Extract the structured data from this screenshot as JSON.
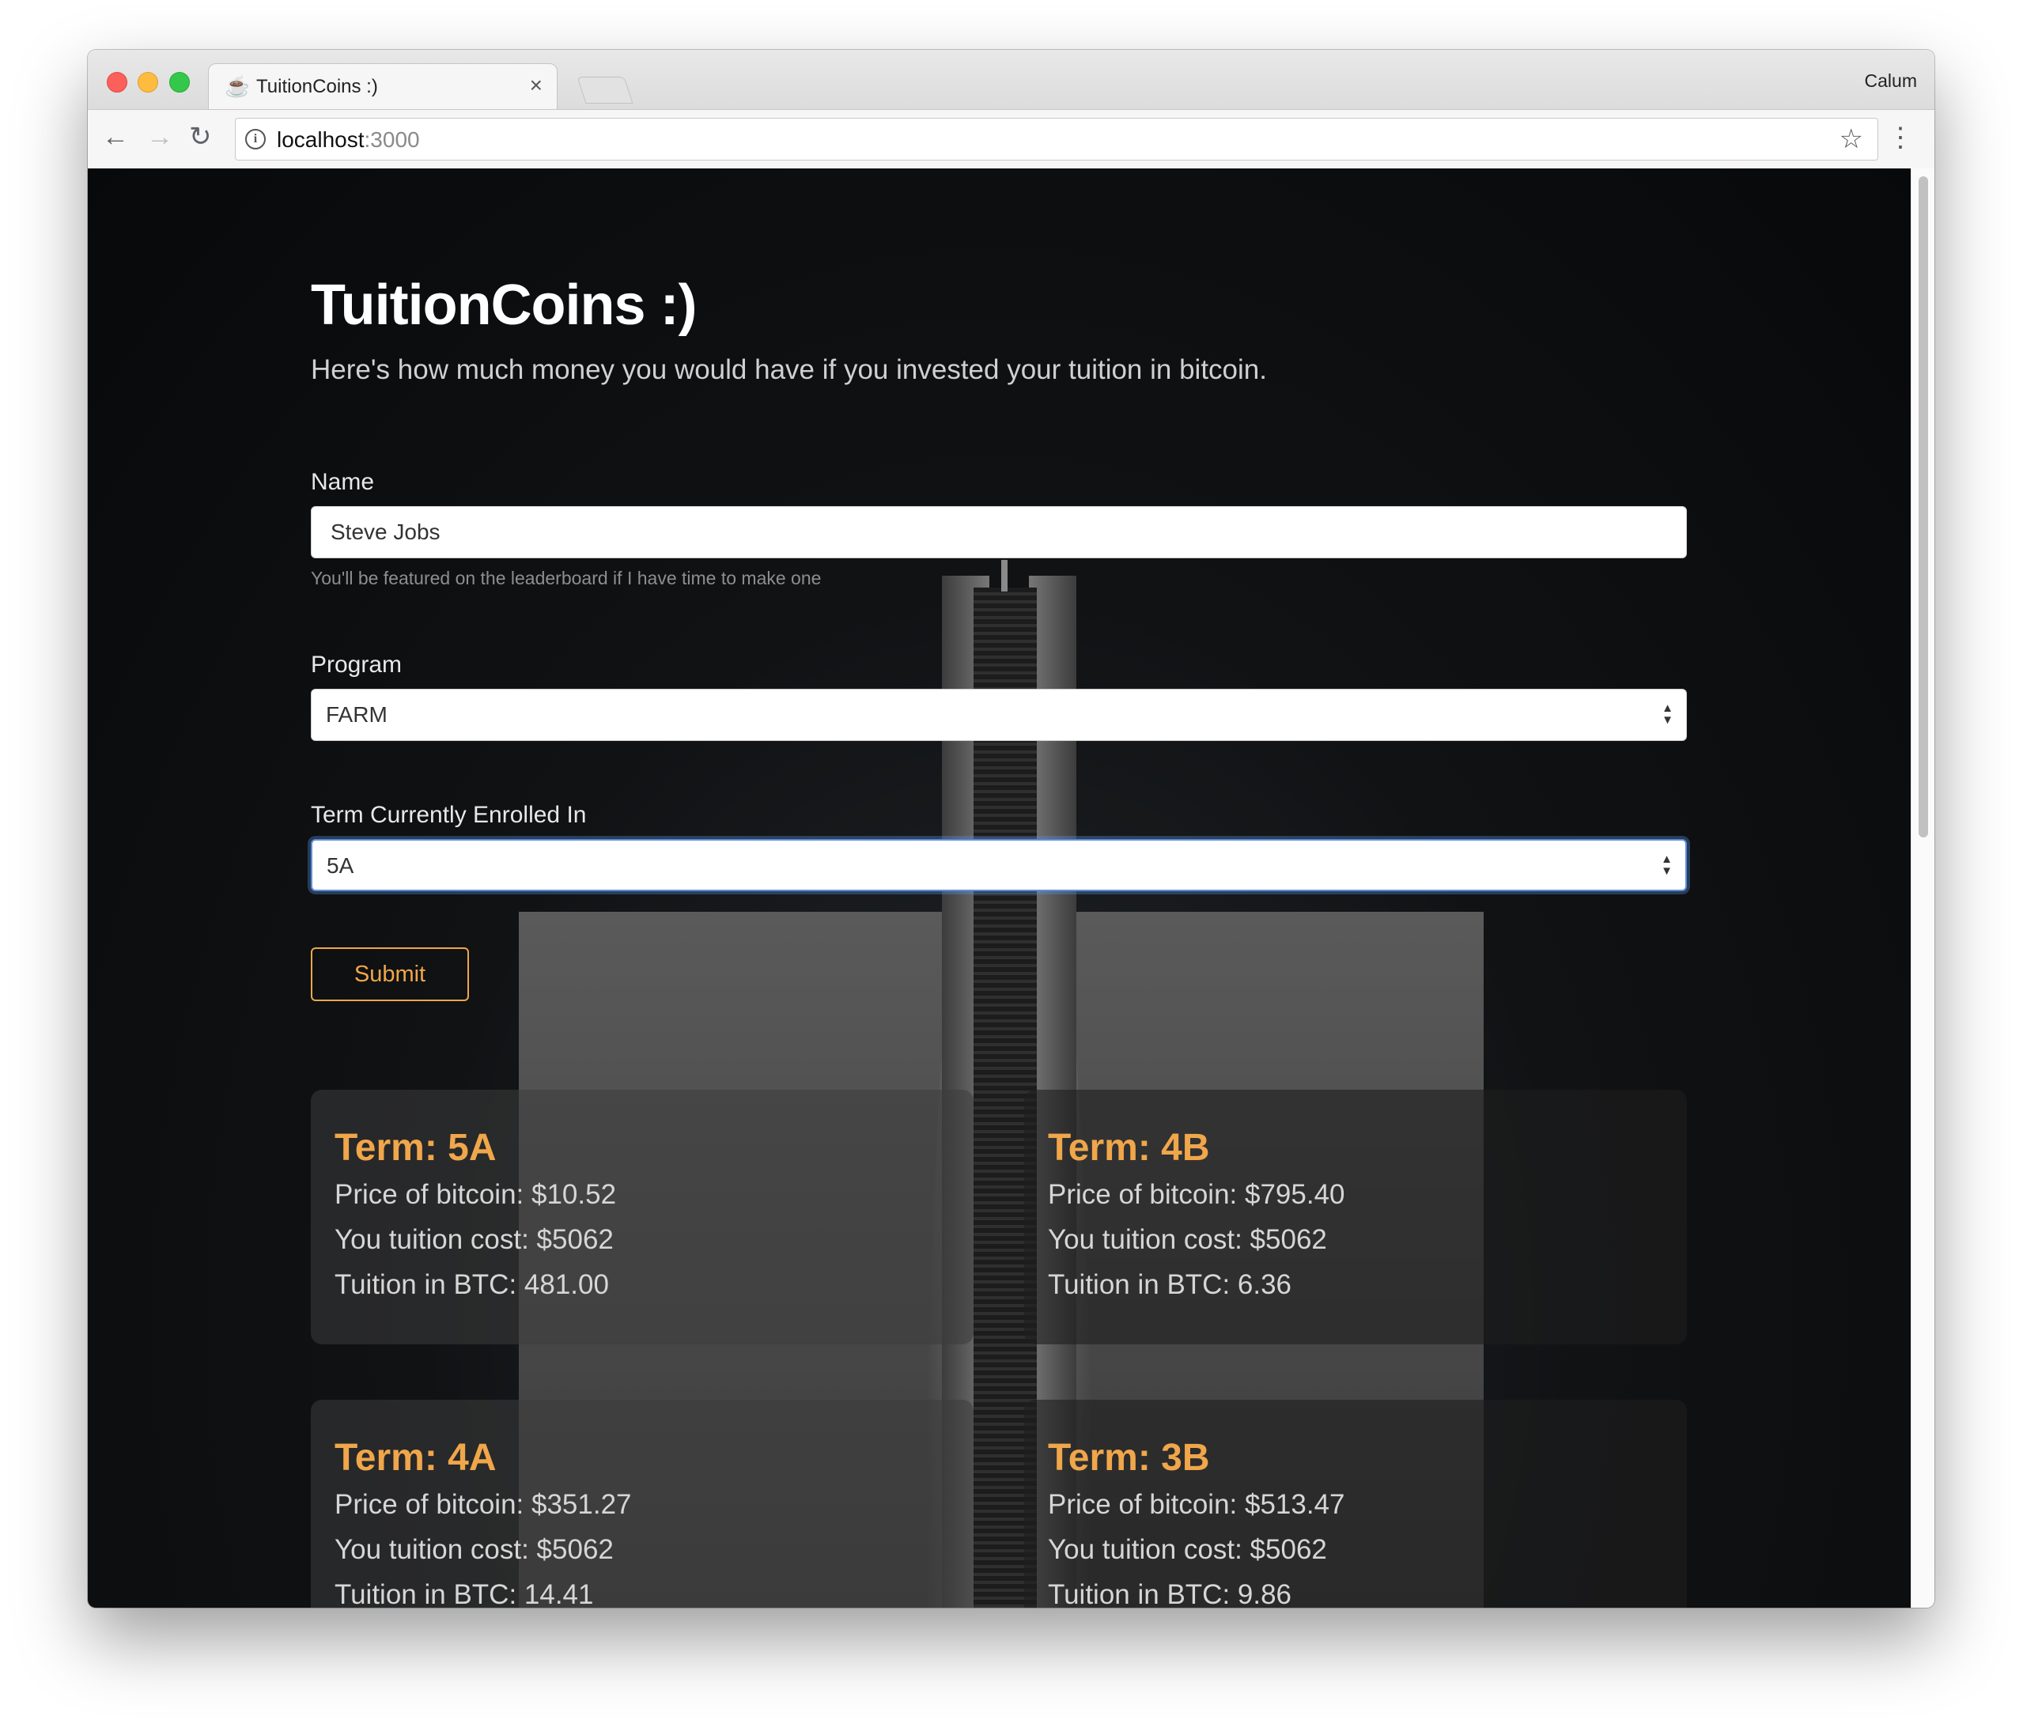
{
  "browser": {
    "tab_title": "TuitionCoins :)",
    "tab_favicon": "☕",
    "profile_name": "Calum",
    "url_host": "localhost",
    "url_port": ":3000"
  },
  "page": {
    "title": "TuitionCoins :)",
    "subtitle": "Here's how much money you would have if you invested your tuition in bitcoin."
  },
  "form": {
    "name_label": "Name",
    "name_value": "Steve Jobs",
    "name_help": "You'll be featured on the leaderboard if I have time to make one",
    "program_label": "Program",
    "program_value": "FARM",
    "term_label": "Term Currently Enrolled In",
    "term_value": "5A",
    "submit_label": "Submit"
  },
  "results": [
    {
      "term": "Term: 5A",
      "price": "Price of bitcoin: $10.52",
      "cost": "You tuition cost: $5062",
      "btc": "Tuition in BTC: 481.00"
    },
    {
      "term": "Term: 4B",
      "price": "Price of bitcoin: $795.40",
      "cost": "You tuition cost: $5062",
      "btc": "Tuition in BTC: 6.36"
    },
    {
      "term": "Term: 4A",
      "price": "Price of bitcoin: $351.27",
      "cost": "You tuition cost: $5062",
      "btc": "Tuition in BTC: 14.41"
    },
    {
      "term": "Term: 3B",
      "price": "Price of bitcoin: $513.47",
      "cost": "You tuition cost: $5062",
      "btc": "Tuition in BTC: 9.86"
    }
  ],
  "colors": {
    "accent": "#f0a64a",
    "background": "#0b0c0e",
    "focus_ring": "#5b8fdc"
  },
  "icons": [
    "back-arrow-icon",
    "forward-arrow-icon",
    "reload-icon",
    "info-icon",
    "star-icon",
    "menu-dots-icon",
    "close-icon",
    "select-arrows-icon"
  ]
}
